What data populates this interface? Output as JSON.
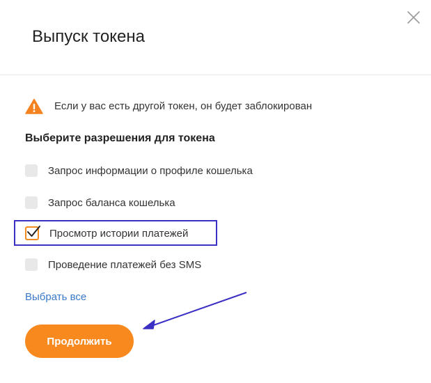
{
  "dialog": {
    "title": "Выпуск токена",
    "close_icon": "close-icon"
  },
  "warning": {
    "icon": "warning-icon",
    "text": "Если у вас есть другой токен, он будет заблокирован"
  },
  "permissions": {
    "heading": "Выберите разрешения для токена",
    "items": [
      {
        "label": "Запрос информации о профиле кошелька",
        "checked": false
      },
      {
        "label": "Запрос баланса кошелька",
        "checked": false
      },
      {
        "label": "Просмотр истории платежей",
        "checked": true
      },
      {
        "label": "Проведение платежей без SMS",
        "checked": false
      }
    ]
  },
  "select_all_label": "Выбрать все",
  "continue_label": "Продолжить",
  "colors": {
    "accent": "#f7891f",
    "link": "#3a79c9",
    "highlight": "#3b2fc4"
  }
}
